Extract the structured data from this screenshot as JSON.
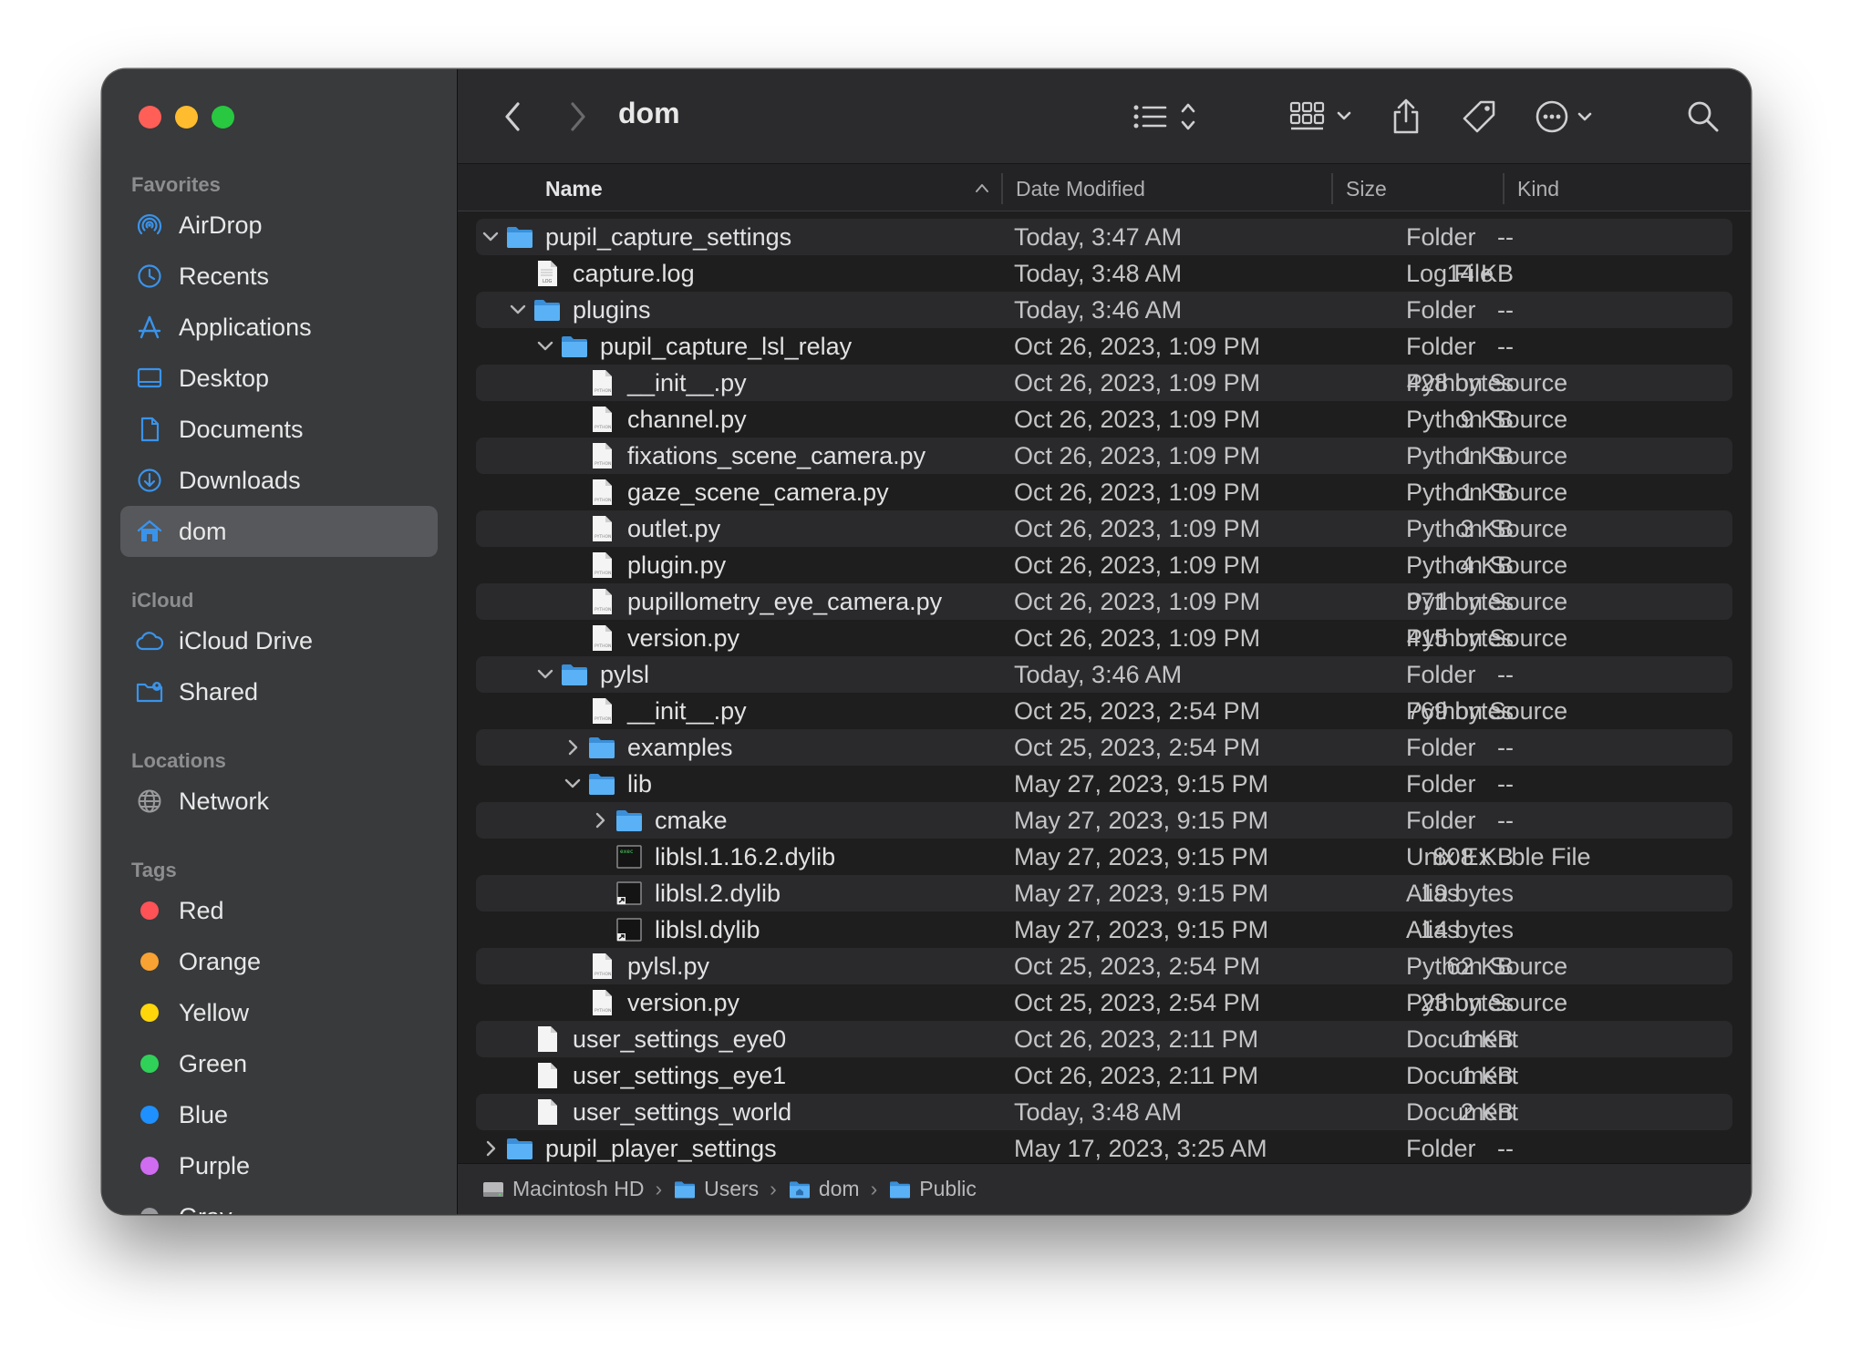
{
  "window": {
    "title": "dom"
  },
  "colors": {
    "accent": "#3a93ea",
    "folder": "#4aa8f2",
    "close": "#ff5f57",
    "minimize": "#febc2e",
    "zoom": "#28c840"
  },
  "sidebar": {
    "favorites_label": "Favorites",
    "favorites": [
      {
        "label": "AirDrop",
        "icon": "airdrop-icon"
      },
      {
        "label": "Recents",
        "icon": "clock-icon"
      },
      {
        "label": "Applications",
        "icon": "applications-icon"
      },
      {
        "label": "Desktop",
        "icon": "desktop-icon"
      },
      {
        "label": "Documents",
        "icon": "document-icon"
      },
      {
        "label": "Downloads",
        "icon": "download-icon"
      },
      {
        "label": "dom",
        "icon": "home-icon",
        "active": true
      }
    ],
    "icloud_label": "iCloud",
    "icloud": [
      {
        "label": "iCloud Drive",
        "icon": "cloud-icon"
      },
      {
        "label": "Shared",
        "icon": "shared-folder-icon"
      }
    ],
    "locations_label": "Locations",
    "locations": [
      {
        "label": "Network",
        "icon": "network-globe-icon"
      }
    ],
    "tags_label": "Tags",
    "tags": [
      {
        "label": "Red",
        "color": "#ff5257"
      },
      {
        "label": "Orange",
        "color": "#f7a233"
      },
      {
        "label": "Yellow",
        "color": "#ffd60a"
      },
      {
        "label": "Green",
        "color": "#30d158"
      },
      {
        "label": "Blue",
        "color": "#1e90ff"
      },
      {
        "label": "Purple",
        "color": "#cf6cf0"
      },
      {
        "label": "Gray",
        "color": "#98989d"
      }
    ]
  },
  "columns": {
    "name": "Name",
    "date": "Date Modified",
    "size": "Size",
    "kind": "Kind"
  },
  "files": [
    {
      "name": "pupil_capture_settings",
      "date": "Today, 3:47 AM",
      "size": "--",
      "kind": "Folder",
      "depth": 0,
      "type": "folder",
      "disclosure": "open"
    },
    {
      "name": "capture.log",
      "date": "Today, 3:48 AM",
      "size": "14 KB",
      "kind": "Log File",
      "depth": 1,
      "type": "log"
    },
    {
      "name": "plugins",
      "date": "Today, 3:46 AM",
      "size": "--",
      "kind": "Folder",
      "depth": 1,
      "type": "folder",
      "disclosure": "open"
    },
    {
      "name": "pupil_capture_lsl_relay",
      "date": "Oct 26, 2023, 1:09 PM",
      "size": "--",
      "kind": "Folder",
      "depth": 2,
      "type": "folder",
      "disclosure": "open"
    },
    {
      "name": "__init__.py",
      "date": "Oct 26, 2023, 1:09 PM",
      "size": "428 bytes",
      "kind": "Python Source",
      "depth": 3,
      "type": "python"
    },
    {
      "name": "channel.py",
      "date": "Oct 26, 2023, 1:09 PM",
      "size": "9 KB",
      "kind": "Python Source",
      "depth": 3,
      "type": "python"
    },
    {
      "name": "fixations_scene_camera.py",
      "date": "Oct 26, 2023, 1:09 PM",
      "size": "1 KB",
      "kind": "Python Source",
      "depth": 3,
      "type": "python"
    },
    {
      "name": "gaze_scene_camera.py",
      "date": "Oct 26, 2023, 1:09 PM",
      "size": "1 KB",
      "kind": "Python Source",
      "depth": 3,
      "type": "python"
    },
    {
      "name": "outlet.py",
      "date": "Oct 26, 2023, 1:09 PM",
      "size": "3 KB",
      "kind": "Python Source",
      "depth": 3,
      "type": "python"
    },
    {
      "name": "plugin.py",
      "date": "Oct 26, 2023, 1:09 PM",
      "size": "4 KB",
      "kind": "Python Source",
      "depth": 3,
      "type": "python"
    },
    {
      "name": "pupillometry_eye_camera.py",
      "date": "Oct 26, 2023, 1:09 PM",
      "size": "971 bytes",
      "kind": "Python Source",
      "depth": 3,
      "type": "python"
    },
    {
      "name": "version.py",
      "date": "Oct 26, 2023, 1:09 PM",
      "size": "415 bytes",
      "kind": "Python Source",
      "depth": 3,
      "type": "python"
    },
    {
      "name": "pylsl",
      "date": "Today, 3:46 AM",
      "size": "--",
      "kind": "Folder",
      "depth": 2,
      "type": "folder",
      "disclosure": "open"
    },
    {
      "name": "__init__.py",
      "date": "Oct 25, 2023, 2:54 PM",
      "size": "769 bytes",
      "kind": "Python Source",
      "depth": 3,
      "type": "python"
    },
    {
      "name": "examples",
      "date": "Oct 25, 2023, 2:54 PM",
      "size": "--",
      "kind": "Folder",
      "depth": 3,
      "type": "folder",
      "disclosure": "closed"
    },
    {
      "name": "lib",
      "date": "May 27, 2023, 9:15 PM",
      "size": "--",
      "kind": "Folder",
      "depth": 3,
      "type": "folder",
      "disclosure": "open"
    },
    {
      "name": "cmake",
      "date": "May 27, 2023, 9:15 PM",
      "size": "--",
      "kind": "Folder",
      "depth": 4,
      "type": "folder",
      "disclosure": "closed"
    },
    {
      "name": "liblsl.1.16.2.dylib",
      "date": "May 27, 2023, 9:15 PM",
      "size": "808 KB",
      "kind": "Unix Ex...ble File",
      "depth": 4,
      "type": "exec"
    },
    {
      "name": "liblsl.2.dylib",
      "date": "May 27, 2023, 9:15 PM",
      "size": "19 bytes",
      "kind": "Alias",
      "depth": 4,
      "type": "alias"
    },
    {
      "name": "liblsl.dylib",
      "date": "May 27, 2023, 9:15 PM",
      "size": "14 bytes",
      "kind": "Alias",
      "depth": 4,
      "type": "alias"
    },
    {
      "name": "pylsl.py",
      "date": "Oct 25, 2023, 2:54 PM",
      "size": "62 KB",
      "kind": "Python Source",
      "depth": 3,
      "type": "python"
    },
    {
      "name": "version.py",
      "date": "Oct 25, 2023, 2:54 PM",
      "size": "23 bytes",
      "kind": "Python Source",
      "depth": 3,
      "type": "python"
    },
    {
      "name": "user_settings_eye0",
      "date": "Oct 26, 2023, 2:11 PM",
      "size": "1 KB",
      "kind": "Document",
      "depth": 1,
      "type": "doc"
    },
    {
      "name": "user_settings_eye1",
      "date": "Oct 26, 2023, 2:11 PM",
      "size": "1 KB",
      "kind": "Document",
      "depth": 1,
      "type": "doc"
    },
    {
      "name": "user_settings_world",
      "date": "Today, 3:48 AM",
      "size": "2 KB",
      "kind": "Document",
      "depth": 1,
      "type": "doc"
    },
    {
      "name": "pupil_player_settings",
      "date": "May 17, 2023, 3:25 AM",
      "size": "--",
      "kind": "Folder",
      "depth": 0,
      "type": "folder",
      "disclosure": "closed"
    }
  ],
  "pathbar": [
    {
      "label": "Macintosh HD",
      "icon": "hard-drive-icon"
    },
    {
      "label": "Users",
      "icon": "folder-icon"
    },
    {
      "label": "dom",
      "icon": "home-folder-icon"
    },
    {
      "label": "Public",
      "icon": "folder-icon"
    }
  ]
}
